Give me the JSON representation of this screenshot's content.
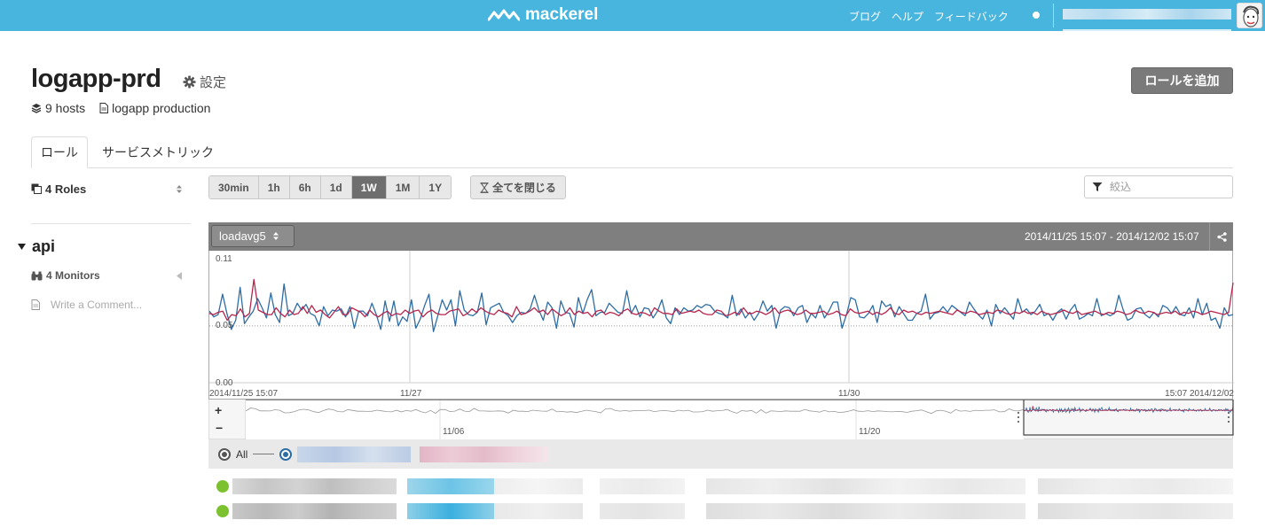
{
  "topbar": {
    "logo_text": "mackerel",
    "links": [
      "ブログ",
      "ヘルプ",
      "フィードバック"
    ],
    "brand_color": "#47b5dd"
  },
  "service": {
    "name": "logapp-prd",
    "settings_label": "設定",
    "hosts_label": "9 hosts",
    "description": "logapp production",
    "add_role_label": "ロールを追加"
  },
  "tabs": [
    {
      "label": "ロール",
      "active": true
    },
    {
      "label": "サービスメトリック",
      "active": false
    }
  ],
  "sidebar": {
    "roles_label": "4 Roles",
    "role": {
      "name": "api",
      "monitors_label": "4 Monitors",
      "comment_placeholder": "Write a Comment..."
    }
  },
  "toolbar": {
    "ranges": [
      {
        "label": "30min",
        "active": false
      },
      {
        "label": "1h",
        "active": false
      },
      {
        "label": "6h",
        "active": false
      },
      {
        "label": "1d",
        "active": false
      },
      {
        "label": "1W",
        "active": true
      },
      {
        "label": "1M",
        "active": false
      },
      {
        "label": "1Y",
        "active": false
      }
    ],
    "collapse_all_label": "全てを閉じる",
    "filter_placeholder": "絞込"
  },
  "graph": {
    "metric": "loadavg5",
    "range_text": "2014/11/25 15:07 - 2014/12/02 15:07",
    "legend_all": "All",
    "nav_zoom_in": "+",
    "nav_zoom_out": "−"
  },
  "chart_data": {
    "type": "line",
    "x_start_label": "2014/11/25 15:07",
    "x_end_label": "15:07 2014/12/02",
    "x_ticks": [
      "11/27",
      "11/30"
    ],
    "y_ticks": [
      "0.11",
      "0.05",
      "0.00"
    ],
    "ylim": [
      0,
      0.11
    ],
    "nav_ticks": [
      "11/06",
      "11/20"
    ],
    "series": [
      {
        "color": "#2e6da4",
        "values": [
          0.063,
          0.058,
          0.06,
          0.078,
          0.061,
          0.047,
          0.055,
          0.084,
          0.052,
          0.058,
          0.063,
          0.074,
          0.066,
          0.057,
          0.079,
          0.06,
          0.053,
          0.087,
          0.059,
          0.061,
          0.07,
          0.064,
          0.069,
          0.061,
          0.059,
          0.05,
          0.067,
          0.059,
          0.064,
          0.063,
          0.065,
          0.058,
          0.067,
          0.048,
          0.063,
          0.063,
          0.059,
          0.07,
          0.06,
          0.047,
          0.072,
          0.054,
          0.072,
          0.05,
          0.058,
          0.054,
          0.073,
          0.048,
          0.056,
          0.068,
          0.078,
          0.045,
          0.059,
          0.073,
          0.064,
          0.073,
          0.05,
          0.081,
          0.064,
          0.06,
          0.059,
          0.062,
          0.079,
          0.051,
          0.066,
          0.068,
          0.07,
          0.062,
          0.059,
          0.053,
          0.059,
          0.062,
          0.061,
          0.065,
          0.077,
          0.064,
          0.055,
          0.071,
          0.066,
          0.048,
          0.072,
          0.062,
          0.061,
          0.049,
          0.075,
          0.061,
          0.073,
          0.082,
          0.059,
          0.062,
          0.062,
          0.07,
          0.066,
          0.062,
          0.061,
          0.081,
          0.061,
          0.068,
          0.058,
          0.066,
          0.065,
          0.057,
          0.063,
          0.073,
          0.057,
          0.052,
          0.066,
          0.06,
          0.066,
          0.063,
          0.064,
          0.068,
          0.066,
          0.069,
          0.068,
          0.063,
          0.061,
          0.06,
          0.057,
          0.077,
          0.059,
          0.065,
          0.057,
          0.062,
          0.055,
          0.061,
          0.072,
          0.063,
          0.068,
          0.048,
          0.064,
          0.067,
          0.066,
          0.059,
          0.066,
          0.068,
          0.053,
          0.061,
          0.057,
          0.068,
          0.057,
          0.063,
          0.071,
          0.071,
          0.048,
          0.06,
          0.075,
          0.073,
          0.058,
          0.057,
          0.061,
          0.068,
          0.053,
          0.072,
          0.067,
          0.069,
          0.058,
          0.067,
          0.061,
          0.055,
          0.055,
          0.061,
          0.063,
          0.078,
          0.056,
          0.061,
          0.062,
          0.067,
          0.062,
          0.068,
          0.065,
          0.062,
          0.059,
          0.071,
          0.065,
          0.06,
          0.056,
          0.064,
          0.05,
          0.069,
          0.061,
          0.066,
          0.061,
          0.056,
          0.074,
          0.062,
          0.065,
          0.06,
          0.063,
          0.069,
          0.059,
          0.061,
          0.055,
          0.062,
          0.065,
          0.056,
          0.064,
          0.069,
          0.056,
          0.058,
          0.061,
          0.059,
          0.074,
          0.059,
          0.061,
          0.059,
          0.061,
          0.077,
          0.064,
          0.055,
          0.057,
          0.065,
          0.066,
          0.06,
          0.057,
          0.062,
          0.058,
          0.068,
          0.066,
          0.061,
          0.067,
          0.06,
          0.059,
          0.066,
          0.057,
          0.074,
          0.06,
          0.07,
          0.055,
          0.057,
          0.048,
          0.066,
          0.059,
          0.06
        ]
      },
      {
        "color": "#b5264c",
        "values": [
          0.061,
          0.06,
          0.062,
          0.063,
          0.055,
          0.06,
          0.059,
          0.065,
          0.058,
          0.061,
          0.091,
          0.064,
          0.062,
          0.06,
          0.06,
          0.066,
          0.061,
          0.058,
          0.064,
          0.06,
          0.061,
          0.067,
          0.061,
          0.068,
          0.062,
          0.064,
          0.06,
          0.057,
          0.062,
          0.067,
          0.06,
          0.06,
          0.066,
          0.064,
          0.062,
          0.058,
          0.064,
          0.06,
          0.058,
          0.061,
          0.063,
          0.059,
          0.061,
          0.06,
          0.064,
          0.061,
          0.063,
          0.064,
          0.058,
          0.062,
          0.064,
          0.061,
          0.06,
          0.06,
          0.063,
          0.064,
          0.065,
          0.059,
          0.061,
          0.065,
          0.062,
          0.066,
          0.063,
          0.061,
          0.06,
          0.064,
          0.062,
          0.061,
          0.058,
          0.067,
          0.06,
          0.061,
          0.063,
          0.066,
          0.062,
          0.064,
          0.06,
          0.065,
          0.062,
          0.059,
          0.061,
          0.066,
          0.06,
          0.063,
          0.061,
          0.062,
          0.058,
          0.063,
          0.064,
          0.06,
          0.062,
          0.061,
          0.059,
          0.063,
          0.065,
          0.061,
          0.06,
          0.062,
          0.061,
          0.059,
          0.066,
          0.063,
          0.061,
          0.061,
          0.06,
          0.065,
          0.061,
          0.062,
          0.063,
          0.062,
          0.064,
          0.061,
          0.06,
          0.06,
          0.064,
          0.063,
          0.059,
          0.06,
          0.062,
          0.06,
          0.066,
          0.061,
          0.061,
          0.063,
          0.062,
          0.06,
          0.062,
          0.066,
          0.061,
          0.063,
          0.064,
          0.062,
          0.06,
          0.061,
          0.064,
          0.061,
          0.061,
          0.062,
          0.063,
          0.06,
          0.061,
          0.063,
          0.06,
          0.059,
          0.065,
          0.062,
          0.061,
          0.062,
          0.063,
          0.06,
          0.062,
          0.06,
          0.062,
          0.066,
          0.061,
          0.06,
          0.064,
          0.062,
          0.063,
          0.061,
          0.06,
          0.062,
          0.061,
          0.062,
          0.063,
          0.062,
          0.061,
          0.06,
          0.064,
          0.062,
          0.061,
          0.063,
          0.062,
          0.06,
          0.061,
          0.062,
          0.061,
          0.064,
          0.063,
          0.061,
          0.06,
          0.062,
          0.061,
          0.063,
          0.061,
          0.062,
          0.06,
          0.063,
          0.061,
          0.06,
          0.061,
          0.062,
          0.064,
          0.062,
          0.061,
          0.063,
          0.06,
          0.061,
          0.062,
          0.063,
          0.061,
          0.06,
          0.062,
          0.061,
          0.063,
          0.062,
          0.06,
          0.061,
          0.064,
          0.062,
          0.061,
          0.063,
          0.062,
          0.06,
          0.061,
          0.062,
          0.061,
          0.063,
          0.06,
          0.062,
          0.061,
          0.063,
          0.062,
          0.06,
          0.061,
          0.063,
          0.062,
          0.061,
          0.06,
          0.062,
          0.088
        ]
      }
    ]
  }
}
